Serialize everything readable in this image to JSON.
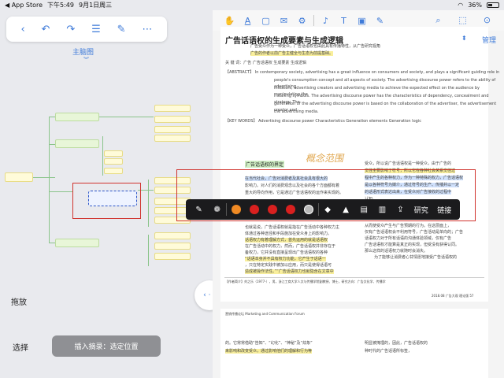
{
  "status_bar": {
    "back_app": "◀ App Store",
    "time": "下午5:49",
    "date": "9月1日周三",
    "battery": "36%",
    "battery_level": 0.36
  },
  "left_toolbar": {
    "icons": [
      "chevron-left-icon",
      "undo-icon",
      "redo-icon",
      "list-icon",
      "pen-icon",
      "more-icon"
    ],
    "glyphs": [
      "‹",
      "↶",
      "↷",
      "☰",
      "✎",
      "⋯"
    ]
  },
  "mindmap_title": "主脑图",
  "mindmap_chevron": "︾",
  "zoom_label": "拖放",
  "select_label": "选择",
  "insert_bar": "插入摘录：选定位置",
  "splitter_label": "‹ · ›",
  "right_toolbar": {
    "glyphs": [
      "✋",
      "A",
      "▢",
      "✉",
      "⚙",
      "♪",
      "T",
      "▣",
      "✎"
    ],
    "right_glyphs": [
      "⌕",
      "⬚",
      "⊙"
    ]
  },
  "manage_label": "管理",
  "updown": "⬍",
  "paper": {
    "title": "广告话语权的生成要素与生成逻辑",
    "lines": [
      "广告受众作为一种受众，广告话语权也由此具有传播特性，从广告研究视角",
      "广告的作者以前广告主健全与生态为前提基础。",
      "关  键 词：广告  广告话语权  生成要素  生成逻辑",
      "【ABSTRACT】 In contemporary society, advertising has a great influence on consumers and society, and plays a significant guiding role in",
      "people's consumption concept and all aspects of society. The advertising discourse power refers to the ability of advertising",
      "initiators, advertising creators and advertising media to achieve the expected effect on the audience by manipulating the",
      "meaning symbols. The advertising discourse power has the characteristics of dependency, concealment and strategy. The",
      "generation of the advertising discourse power is based on the collaboration of the advertiser, the advertisement creator and",
      "the advertising media.",
      "【KEY WORDS】 Advertising  discourse power  Characteristics  Generation elements  Generation logic"
    ],
    "section_head": "广告话语权的界定",
    "handwriting": "概念范围",
    "left_col": [
      "在当代社会，广告对消费者及其社会具有很大的",
      "影响力。对人们的消费观念以及社会的各个方面都有着",
      "重大的导向作用，它是通过广告话语权的运作来实现的。",
      "也就是说，广告话语权就是指在广告活动中各种权力主",
      "体通过各种途径和手段施加在受众身上的影响力。",
      "话语权力有着理解方式，首先运用的就是话语权",
      "在广告活动中的权力，然而，广告话语权并非存在于",
      "备权力，它并没有直接呈现出广告话语权的各种",
      "“话语本身并不具有权力功能，它产生于话语一",
      "，只在特定实践中被加以应用，而只是使得话语可",
      "造成被操作法性。”“广告话语权力也就隐含在文章中"
    ],
    "right_col": [
      "受众，所以说广告话语权是一种受众，由于广告的",
      "交往主要影响于符号，所以它在各种社会关系交往过",
      "程中产生的各种权力，作为一种特殊的权力，广告话语权",
      "是以各种符号为媒介，通过符号的生产、传播并以一定",
      "的话语形式表达出来，在受众对广告接收的过程中",
      "认知。",
      "从而使受众产生与广告预期的行为。在这层面上，",
      "仅有广告话语权会不利用符号，广告活动是单向的；广告",
      "话语权力对于所有话语的沟通体验领域，仅有广告",
      "广告话语权才能算是真正的实现，但受没有获得认同。",
      "那么这样的话语权力就随时会消失。",
      "为了能够让消费者心甘情愿地接受广告话语权的"
    ],
    "footnote": "【作者简介】刘之乐（1977-），男，浙江工商大学人文与传播学院副教授、博士，研究方向：广告文化学、传播学",
    "page_footer": "2018.08  广告大观  理论版  57",
    "page2_header": "营销传播论坛  Marketing and Communication Forum",
    "page2_left": [
      "的。它常常借助“告知”、“幻化”、“神秘”及“炫象”",
      "来影响和改变受众，通过影响他们的理解和行为等"
    ],
    "page2_right": [
      "明显被掩埋的，因此，广告话语权的",
      "种时代的广告话语所标签，"
    ]
  },
  "context_menu": {
    "items": [
      "edit-icon",
      "palette-icon",
      "color-orange",
      "color-red-1",
      "color-red-2",
      "color-red-3",
      "color-grey",
      "tag-icon",
      "pen-plus-icon",
      "clipboard-plus-icon",
      "trash-icon",
      "share-icon"
    ],
    "research": "研究",
    "link": "链接",
    "colors": {
      "orange": "#f08a24",
      "red": "#d9201f",
      "grey": "#b8b8b8",
      "accent": "#3f7bd9"
    }
  }
}
